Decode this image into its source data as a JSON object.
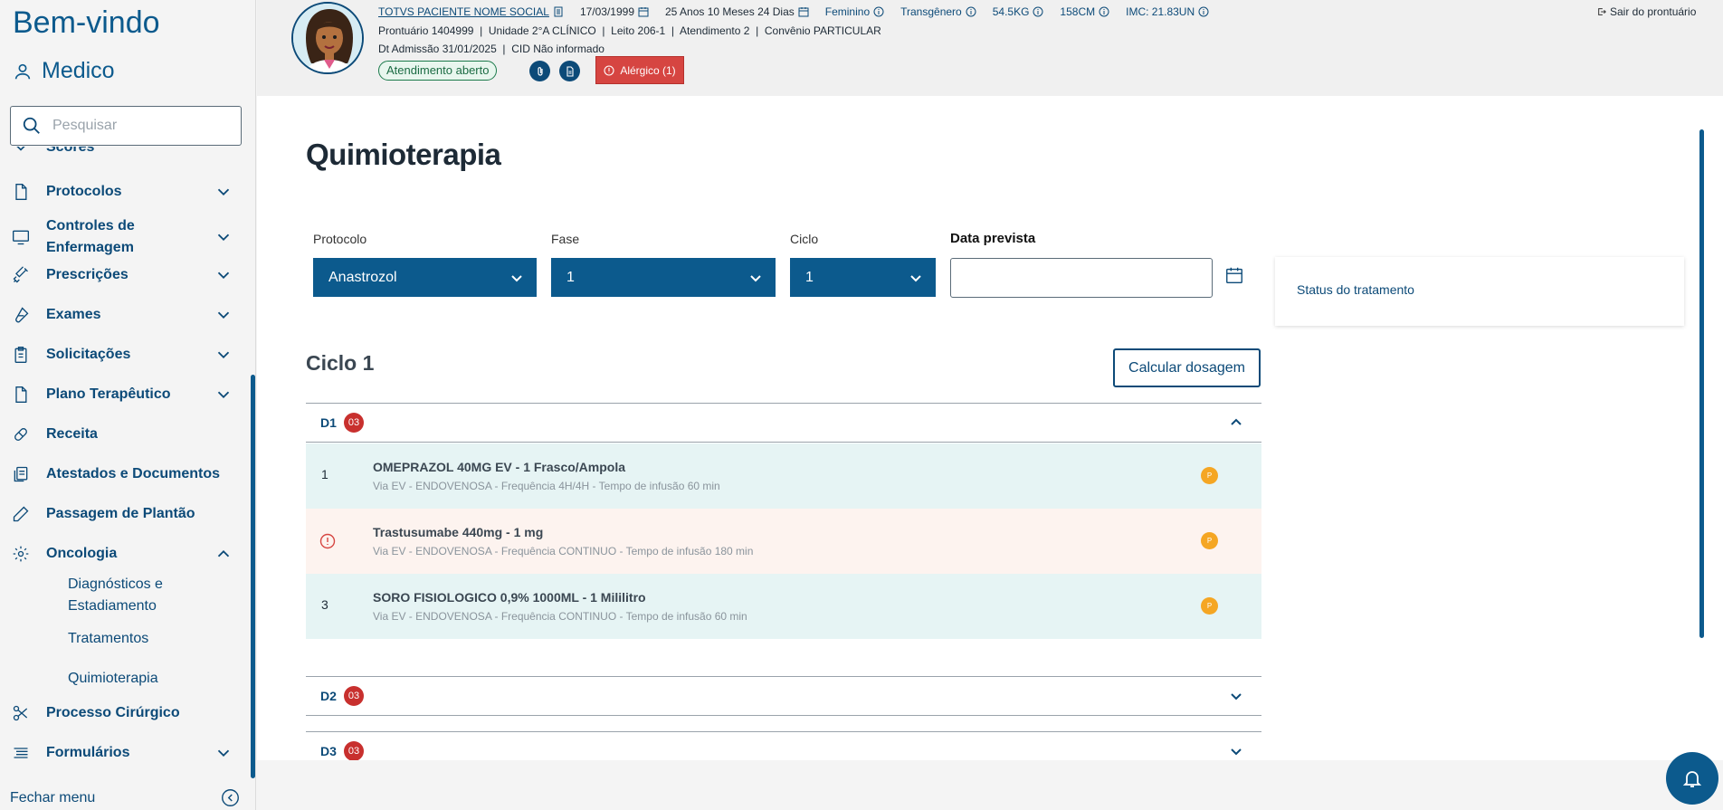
{
  "sidebar": {
    "welcome": "Bem-vindo",
    "user": "Medico",
    "search_placeholder": "Pesquisar",
    "items": [
      {
        "label": "Scores"
      },
      {
        "label": "Protocolos"
      },
      {
        "label": "Controles de Enfermagem"
      },
      {
        "label": "Prescrições"
      },
      {
        "label": "Exames"
      },
      {
        "label": "Solicitações"
      },
      {
        "label": "Plano Terapêutico"
      },
      {
        "label": "Receita"
      },
      {
        "label": "Atestados e Documentos"
      },
      {
        "label": "Passagem de Plantão"
      },
      {
        "label": "Oncologia"
      },
      {
        "label": "Processo Cirúrgico"
      },
      {
        "label": "Formulários"
      }
    ],
    "oncology_sub": [
      "Diagnósticos e Estadiamento",
      "Tratamentos",
      "Quimioterapia"
    ],
    "close_menu": "Fechar menu"
  },
  "patient": {
    "name": "TOTVS PACIENTE NOME SOCIAL",
    "birth": "17/03/1999",
    "age": "25 Anos 10 Meses 24 Dias",
    "sex": "Feminino",
    "gender": "Transgênero",
    "weight": "54.5KG",
    "height": "158CM",
    "imc": "IMC: 21.83UN",
    "line2": "Prontuário 1404999  |  Unidade 2°A CLÍNICO  |  Leito 206-1  |  Atendimento 2  |  Convênio PARTICULAR",
    "line3": "Dt Admissão 31/01/2025  |  CID Não informado",
    "status": "Atendimento aberto",
    "allergy": "Alérgico (1)",
    "exit": "Sair do prontuário"
  },
  "page": {
    "title": "Quimioterapia",
    "protocol_label": "Protocolo",
    "protocol_value": "Anastrozol",
    "phase_label": "Fase",
    "phase_value": "1",
    "cycle_label": "Ciclo",
    "cycle_value": "1",
    "date_label": "Data prevista",
    "date_value": "",
    "status_card": "Status do tratamento",
    "cycle_title": "Ciclo 1",
    "calc_button": "Calcular dosagem"
  },
  "days": [
    {
      "label": "D1",
      "count": "03",
      "expanded": true
    },
    {
      "label": "D2",
      "count": "03",
      "expanded": false
    },
    {
      "label": "D3",
      "count": "03",
      "expanded": false
    }
  ],
  "drugs": [
    {
      "num": "1",
      "name": "OMEPRAZOL 40MG EV - 1 Frasco/Ampola",
      "desc": "Via EV - ENDOVENOSA - Frequência 4H/4H - Tempo de infusão 60 min",
      "badge": "P",
      "warning": false
    },
    {
      "num": "",
      "name": "Trastusumabe 440mg - 1 mg",
      "desc": "Via EV - ENDOVENOSA - Frequência CONTINUO - Tempo de infusão 180 min",
      "badge": "P",
      "warning": true
    },
    {
      "num": "3",
      "name": "SORO FISIOLOGICO 0,9% 1000ML - 1 Mililitro",
      "desc": "Via EV - ENDOVENOSA - Frequência CONTINUO - Tempo de infusão 60 min",
      "badge": "P",
      "warning": false
    }
  ],
  "colors": {
    "primary": "#0c5a8d",
    "navy": "#0c4a78",
    "danger": "#d64541",
    "badge_red": "#c8302e",
    "badge_orange": "#f5a623",
    "row_ok": "#e6f4f4",
    "row_warn": "#fdf3ef",
    "status_green": "#1b6b43"
  },
  "icons": {
    "user": "user-icon",
    "search": "search-icon",
    "calendar": "calendar-icon",
    "bell": "bell-icon",
    "info": "info-icon",
    "exit": "exit-icon"
  }
}
